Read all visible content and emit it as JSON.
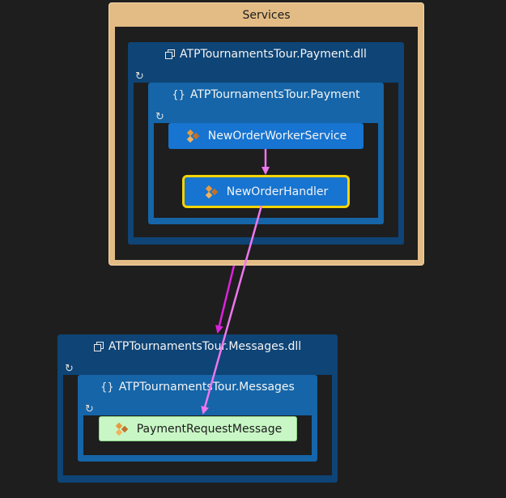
{
  "services_group": {
    "title": "Services"
  },
  "payment_assembly": {
    "title": "ATPTournamentsTour.Payment.dll",
    "namespace": {
      "title": "ATPTournamentsTour.Payment",
      "classes": [
        "NewOrderWorkerService",
        "NewOrderHandler"
      ]
    }
  },
  "messages_assembly": {
    "title": "ATPTournamentsTour.Messages.dll",
    "namespace": {
      "title": "ATPTournamentsTour.Messages",
      "classes": [
        "PaymentRequestMessage"
      ]
    }
  },
  "colors": {
    "group": "#e3bc85",
    "assembly": "#0e4476",
    "namespace": "#1565a8",
    "class": "#1774d0",
    "selected_border": "#f5d400",
    "message_class": "#c8f7c5",
    "edge": "#ee77ee",
    "edge_strong": "#dd22dd"
  },
  "icons": {
    "assembly": "assembly-icon",
    "namespace": "namespace-icon",
    "class": "class-icon",
    "expand": "refresh-icon"
  }
}
